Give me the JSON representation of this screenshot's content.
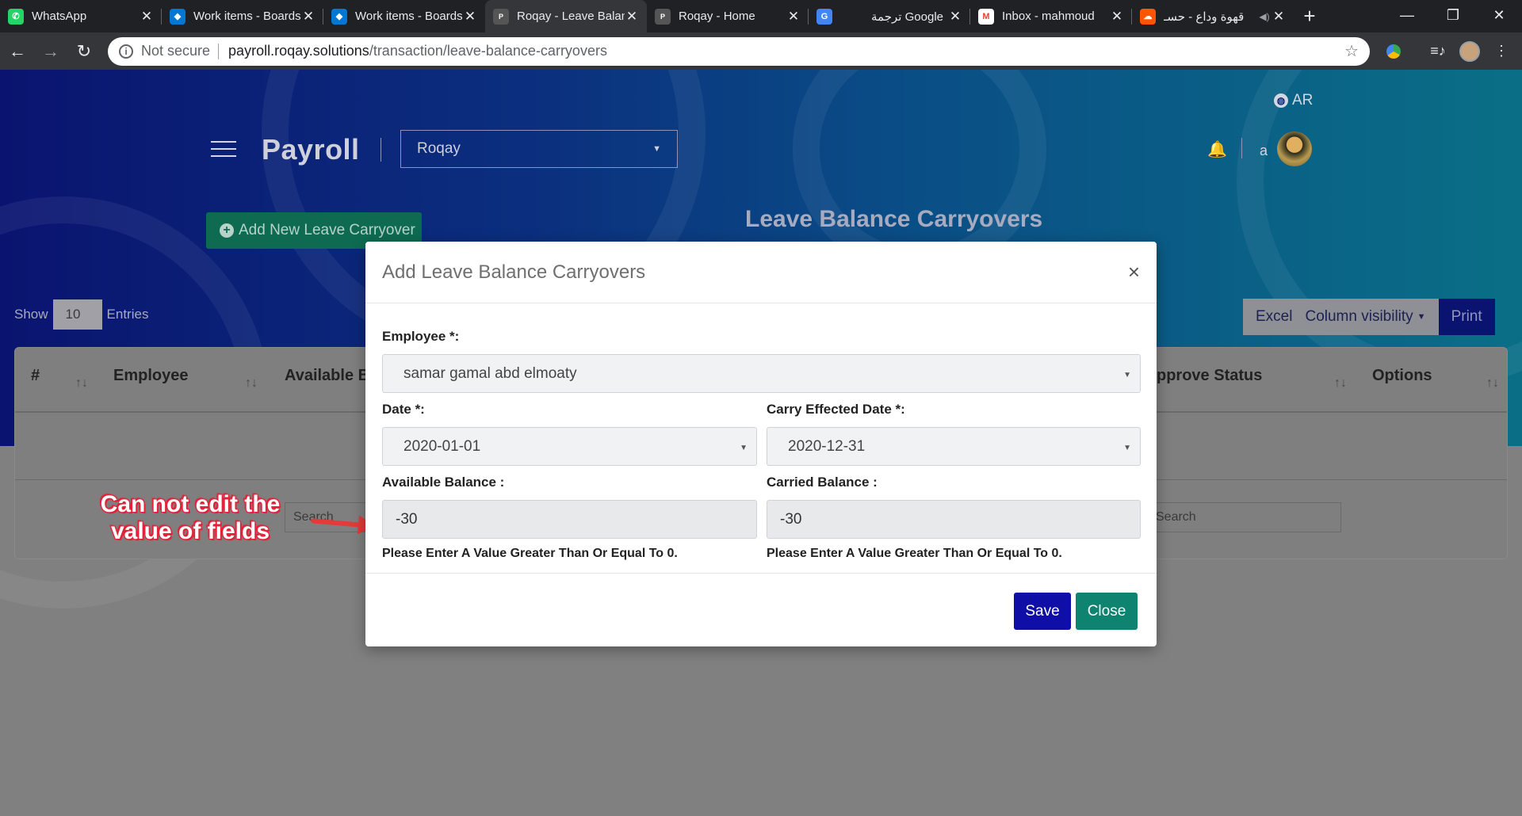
{
  "browser": {
    "tabs": [
      {
        "title": "WhatsApp",
        "icon": "whatsapp-icon",
        "color": "#25d366",
        "glyph": "✆"
      },
      {
        "title": "Work items - Boards",
        "icon": "azure-devops-icon",
        "color": "#0078d4",
        "glyph": "◆"
      },
      {
        "title": "Work items - Boards",
        "icon": "azure-devops-icon",
        "color": "#0078d4",
        "glyph": "◆"
      },
      {
        "title": "Roqay - Leave Balance",
        "icon": "payroll-icon",
        "color": "#35363a",
        "glyph": "P"
      },
      {
        "title": "Roqay - Home",
        "icon": "payroll-icon",
        "color": "#202124",
        "glyph": "P"
      },
      {
        "title": "ترجمة Google",
        "icon": "google-translate-icon",
        "color": "#4285f4",
        "glyph": "G"
      },
      {
        "title": "Inbox - mahmoud",
        "icon": "gmail-icon",
        "color": "#ea4335",
        "glyph": "M"
      },
      {
        "title": "قهوة وداع - حسـ",
        "icon": "soundcloud-icon",
        "color": "#ff5500",
        "glyph": "☁"
      }
    ],
    "active_tab": 3,
    "url": {
      "security": "Not secure",
      "host": "payroll.roqay.solutions",
      "path": "/transaction/leave-balance-carryovers"
    }
  },
  "header": {
    "lang": "AR",
    "brand": "Payroll",
    "company": "Roqay",
    "user": "a",
    "add_button": "Add New Leave Carryover",
    "page_title": "Leave Balance Carryovers"
  },
  "table": {
    "show_label": "Show",
    "entries_value": "10",
    "entries_label": "Entries",
    "buttons": {
      "excel": "Excel",
      "colvis": "Column visibility",
      "print": "Print"
    },
    "columns": [
      "#",
      "Employee",
      "Available Ba",
      "pprove Status",
      "Options"
    ],
    "search_placeholder": "Search"
  },
  "annotation": "Can not edit the value of fields",
  "modal": {
    "title": "Add Leave Balance Carryovers",
    "employee_label": "Employee *:",
    "employee_value": "samar gamal abd elmoaty",
    "date_label": "Date *:",
    "date_value": "2020-01-01",
    "carry_date_label": "Carry Effected Date *:",
    "carry_date_value": "2020-12-31",
    "available_label": "Available Balance :",
    "available_value": "-30",
    "available_error": "Please Enter A Value Greater Than Or Equal To 0.",
    "carried_label": "Carried Balance :",
    "carried_value": "-30",
    "carried_error": "Please Enter A Value Greater Than Or Equal To 0.",
    "save": "Save",
    "close": "Close"
  },
  "colors": {
    "save": "#0f0fa8",
    "close": "#0e8370",
    "annotation_arrow": "#e53a3a"
  }
}
